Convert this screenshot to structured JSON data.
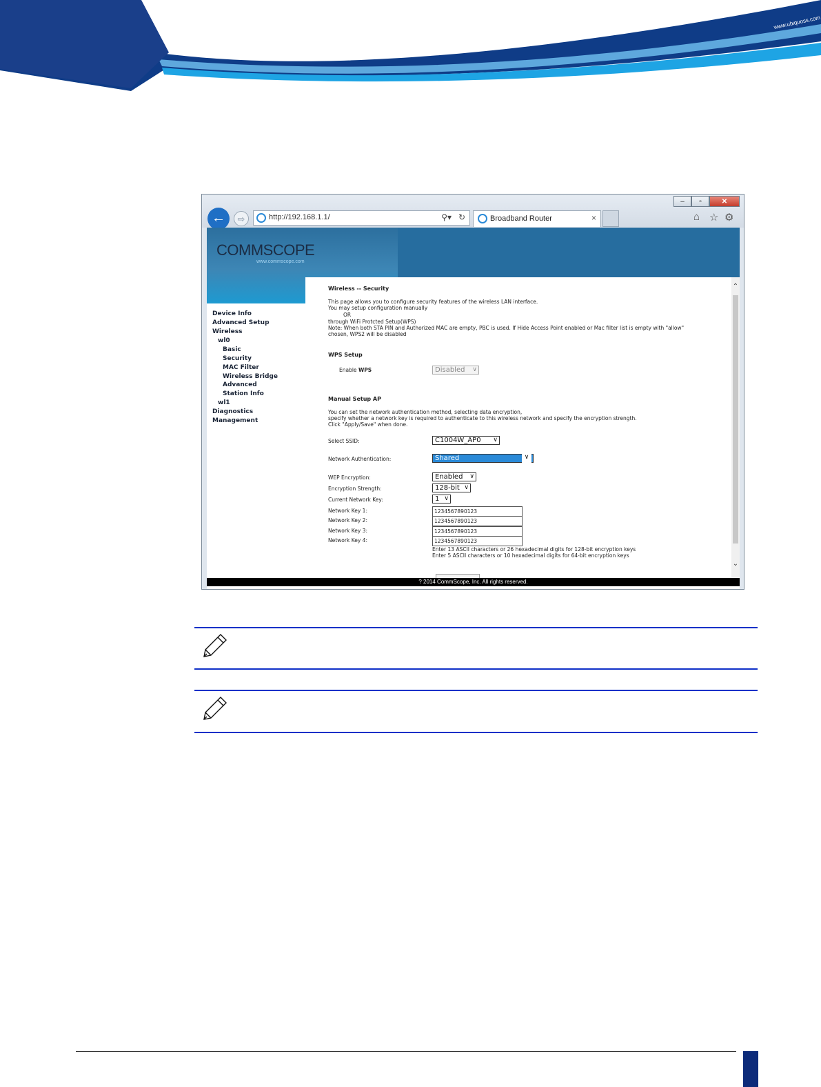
{
  "document": {
    "header_url": "www.ubiquoss.com"
  },
  "browser": {
    "window_buttons": {
      "minimize": "–",
      "maximize": "▫",
      "close": "✕"
    },
    "address": "http://192.168.1.1/",
    "tab_title": "Broadband Router",
    "tab_close": "×",
    "toolbar_icons": [
      "home-icon",
      "star-icon",
      "gear-icon"
    ]
  },
  "router": {
    "logo_text": "COMMSCOPE",
    "logo_sub": "www.commscope.com",
    "nav": [
      "Device Info",
      "Advanced Setup",
      "Wireless",
      "wl0",
      "Basic",
      "Security",
      "MAC Filter",
      "Wireless Bridge",
      "Advanced",
      "Station Info",
      "wl1",
      "Diagnostics",
      "Management"
    ],
    "page_title": "Wireless -- Security",
    "intro": [
      "This page allows you to configure security features of the wireless LAN interface.",
      "You may setup configuration manually",
      "OR",
      "through WiFi Protcted Setup(WPS)",
      "Note: When both STA PIN and Authorized MAC are empty, PBC is used. If Hide Access Point enabled or Mac filter list is empty with \"allow\"",
      "chosen, WPS2 will be disabled"
    ],
    "wps": {
      "heading": "WPS Setup",
      "label_prefix": "Enable",
      "label_bold": "WPS",
      "value": "Disabled"
    },
    "manual": {
      "heading": "Manual Setup AP",
      "desc": [
        "You can set the network authentication method, selecting data encryption,",
        "specify whether a network key is required to authenticate to this wireless network and specify the encryption strength.",
        "Click \"Apply/Save\" when done."
      ],
      "ssid_label": "Select SSID:",
      "ssid_value": "C1004W_AP0",
      "auth_label": "Network Authentication:",
      "auth_value": "Shared",
      "wep_label": "WEP Encryption:",
      "wep_value": "Enabled",
      "strength_label": "Encryption Strength:",
      "strength_value": "128-bit",
      "current_key_label": "Current Network Key:",
      "current_key_value": "1",
      "keys": [
        {
          "label": "Network Key 1:",
          "value": "1234567890123"
        },
        {
          "label": "Network Key 2:",
          "value": "1234567890123"
        },
        {
          "label": "Network Key 3:",
          "value": "1234567890123"
        },
        {
          "label": "Network Key 4:",
          "value": "1234567890123"
        }
      ],
      "hints": [
        "Enter 13 ASCII characters or 26 hexadecimal digits for 128-bit encryption keys",
        "Enter 5 ASCII characters or 10 hexadecimal digits for 64-bit encryption keys"
      ]
    },
    "footer": "? 2014 CommScope, Inc. All rights reserved."
  },
  "colors": {
    "brand_blue": "#1a3f8a",
    "note_rule": "#1030c8",
    "router_banner": "#266d9f",
    "highlight": "#2a8ad8"
  }
}
